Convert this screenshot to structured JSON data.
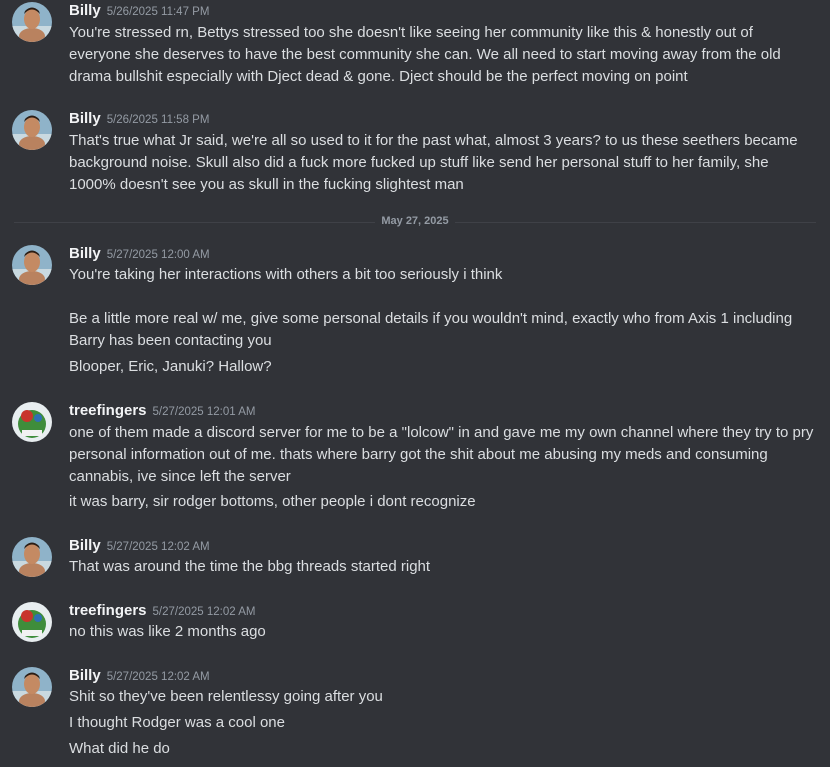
{
  "theme": {
    "background": "#313338",
    "text": "#dbdee1",
    "username": "#f2f3f5",
    "muted": "#949ba4"
  },
  "date_divider": "May 27, 2025",
  "messages": [
    {
      "author": "Billy",
      "time": "5/26/2025 11:47 PM",
      "avatar_icon": "billy-avatar-icon",
      "lines": [
        "You're stressed rn, Bettys stressed too she doesn't like seeing her community like this & honestly out of everyone she deserves to have the best community she can. We all need to start moving away from the old drama bullshit especially with Dject dead & gone. Dject should be the perfect moving on point"
      ]
    },
    {
      "author": "Billy",
      "time": "5/26/2025 11:58 PM",
      "avatar_icon": "billy-avatar-icon",
      "lines": [
        "That's true what Jr said, we're all so used to it for the past what, almost 3 years? to us these seethers became background noise. Skull also did a fuck more fucked up stuff like send her personal stuff to her family, she 1000% doesn't see you as skull in the fucking slightest man"
      ]
    },
    {
      "author": "Billy",
      "time": "5/27/2025 12:00 AM",
      "avatar_icon": "billy-avatar-icon",
      "lines": [
        "You're taking her interactions with others a bit too seriously i think",
        "Be a little more real w/ me, give some personal details if you wouldn't mind, exactly who from Axis 1 including Barry has been contacting you",
        "Blooper, Eric, Januki? Hallow?"
      ]
    },
    {
      "author": "treefingers",
      "time": "5/27/2025 12:01 AM",
      "avatar_icon": "treefingers-avatar-icon",
      "lines": [
        "one of them made a discord server for me to be a \"lolcow\" in and gave me my own channel where they try to pry personal information out of me. thats where barry got the shit about me abusing my meds and consuming cannabis, ive since left the server",
        "it was barry, sir rodger bottoms, other people i dont recognize"
      ]
    },
    {
      "author": "Billy",
      "time": "5/27/2025 12:02 AM",
      "avatar_icon": "billy-avatar-icon",
      "lines": [
        "That was around the time the bbg threads started right"
      ]
    },
    {
      "author": "treefingers",
      "time": "5/27/2025 12:02 AM",
      "avatar_icon": "treefingers-avatar-icon",
      "lines": [
        "no this was like 2 months ago"
      ]
    },
    {
      "author": "Billy",
      "time": "5/27/2025 12:02 AM",
      "avatar_icon": "billy-avatar-icon",
      "lines": [
        "Shit so they've been relentlessy going after you",
        "I thought Rodger was a cool one",
        "What did he do"
      ]
    }
  ]
}
